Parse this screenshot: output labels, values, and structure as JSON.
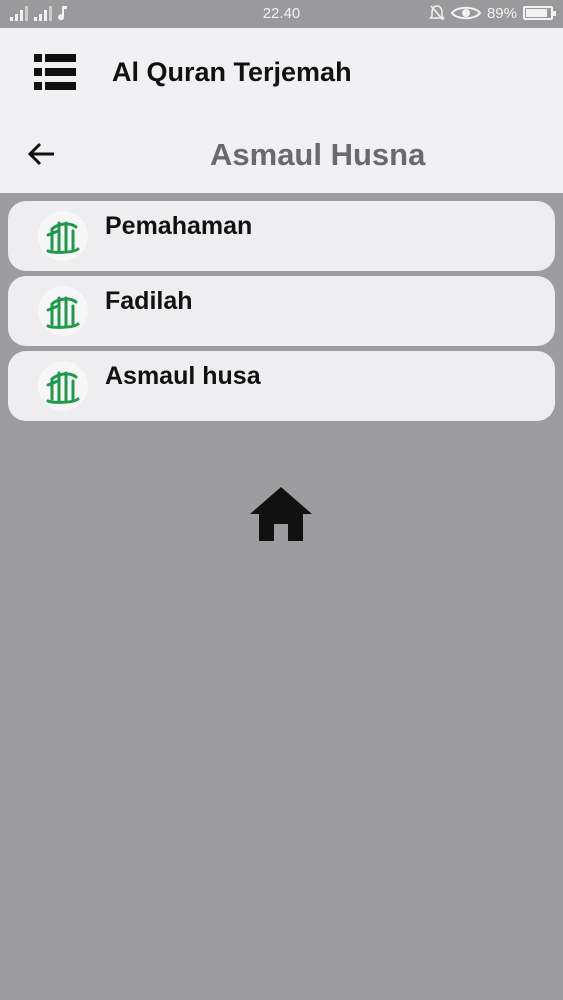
{
  "status_bar": {
    "time": "22.40",
    "battery": "89%",
    "battery_level": 0.89,
    "icons": [
      "signal-icon",
      "signal-icon",
      "music-note-icon",
      "alarm-off-icon",
      "eye-icon",
      "battery-icon"
    ]
  },
  "app_bar": {
    "title": "Al Quran Terjemah",
    "menu_icon": "list-menu-icon"
  },
  "header": {
    "title": "Asmaul Husna",
    "back_icon": "arrow-back-icon"
  },
  "menu": {
    "items": [
      {
        "label": "Pemahaman",
        "icon": "allah-calligraphy-icon"
      },
      {
        "label": "Fadilah",
        "icon": "allah-calligraphy-icon"
      },
      {
        "label": "Asmaul husa",
        "icon": "allah-calligraphy-icon"
      }
    ]
  },
  "footer": {
    "home_icon": "home-icon"
  },
  "colors": {
    "background": "#9d9c9f",
    "bar": "#f1f0f2",
    "card": "#eeedef",
    "calligraphy": "#1f9a4a",
    "header_title": "#6a696d"
  }
}
